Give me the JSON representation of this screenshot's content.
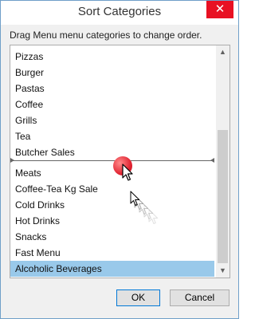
{
  "window": {
    "title": "Sort Categories",
    "close_glyph": "✕"
  },
  "instruction": "Drag Menu menu categories to change order.",
  "list": {
    "items": [
      "Pizzas",
      "Burger",
      "Pastas",
      "Coffee",
      "Grills",
      "Tea",
      "Butcher Sales",
      "Meats",
      "Coffee-Tea Kg Sale",
      "Cold Drinks",
      "Hot Drinks",
      "Snacks",
      "Fast Menu",
      "Alcoholic Beverages"
    ],
    "selected": "Alcoholic Beverages",
    "selected_color": "#99c9ea"
  },
  "scrollbar": {
    "up_glyph": "▲",
    "down_glyph": "▼"
  },
  "buttons": {
    "ok": "OK",
    "cancel": "Cancel"
  },
  "colors": {
    "close_button": "#e81123",
    "drag_indicator": "#e0202e"
  },
  "icons": [
    "close-icon",
    "scroll-up-icon",
    "scroll-down-icon",
    "mouse-pointer-icon",
    "click-indicator-icon"
  ]
}
